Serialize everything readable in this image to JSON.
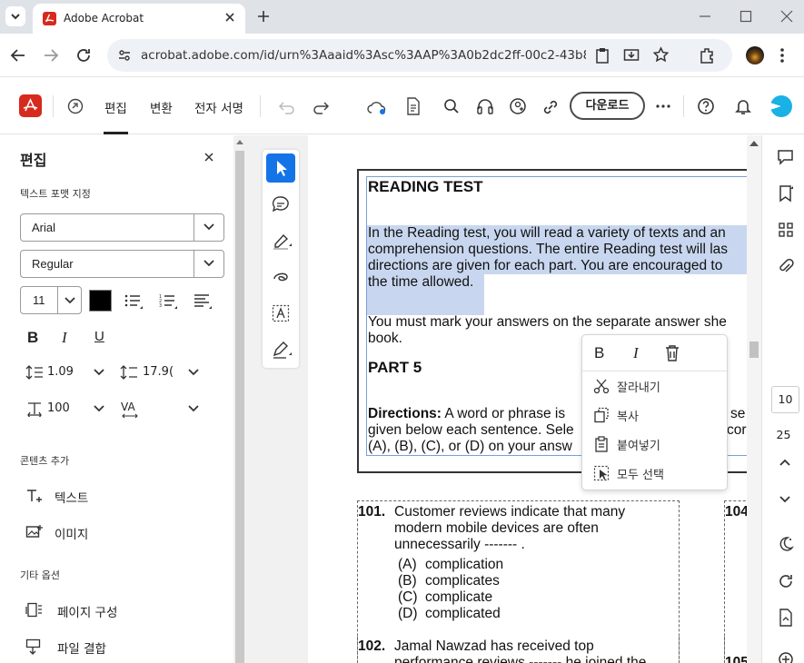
{
  "browser": {
    "tab_title": "Adobe Acrobat",
    "url": "acrobat.adobe.com/id/urn%3Aaaid%3Asc%3AAP%3A0b2dc2ff-00c2-43b8-b..."
  },
  "toolbar": {
    "edit": "편집",
    "convert": "변환",
    "esign": "전자 서명",
    "download": "다운로드"
  },
  "panel": {
    "title": "편집",
    "text_format_label": "텍스트 포맷 지정",
    "font_family": "Arial",
    "font_style": "Regular",
    "font_size": "11",
    "line_spacing": "1.09",
    "para_spacing": "17.9(",
    "scale": "100",
    "kerning_label": "VA",
    "bold": "B",
    "italic": "I",
    "underline": "U",
    "add_content_label": "콘텐츠 추가",
    "add_text": "텍스트",
    "add_image": "이미지",
    "other_options_label": "기타 옵션",
    "page_organize": "페이지 구성",
    "combine_files": "파일 결합"
  },
  "document": {
    "heading": "READING TEST",
    "para1": [
      "In the Reading test, you will read a variety of texts and an",
      "comprehension questions. The entire Reading test will las",
      "directions are given for each part. You are encouraged to",
      "the time allowed."
    ],
    "para2": [
      "You must mark your answers on the separate answer she",
      "book."
    ],
    "part": "PART 5",
    "directions_label": "Directions:",
    "directions": [
      " A word or phrase is",
      "given below each sentence. Sele",
      "(A), (B), (C), or (D) on your answ"
    ],
    "directions_tail": [
      "se",
      "cor"
    ],
    "q101_num": "101.",
    "q101_lines": [
      "Customer reviews indicate that many",
      "modern mobile devices are often",
      "unnecessarily ------- ."
    ],
    "q101_options": [
      {
        "letter": "(A)",
        "text": "complication"
      },
      {
        "letter": "(B)",
        "text": "complicates"
      },
      {
        "letter": "(C)",
        "text": "complicate"
      },
      {
        "letter": "(D)",
        "text": "complicated"
      }
    ],
    "q102_num": "102.",
    "q102_lines": [
      "Jamal Nawzad has received top",
      "performance reviews ------- he joined the"
    ],
    "q104_num": "104",
    "q105_num": "105"
  },
  "context_menu": {
    "bold": "B",
    "italic": "I",
    "cut": "잘라내기",
    "copy": "복사",
    "paste": "붙여넣기",
    "select_all": "모두 선택"
  },
  "rail": {
    "current_page": "10",
    "total_pages": "25"
  },
  "colors": {
    "acrobat_red": "#d62a1e",
    "selection": "#c8d7ef",
    "active_tool": "#1473e6"
  }
}
